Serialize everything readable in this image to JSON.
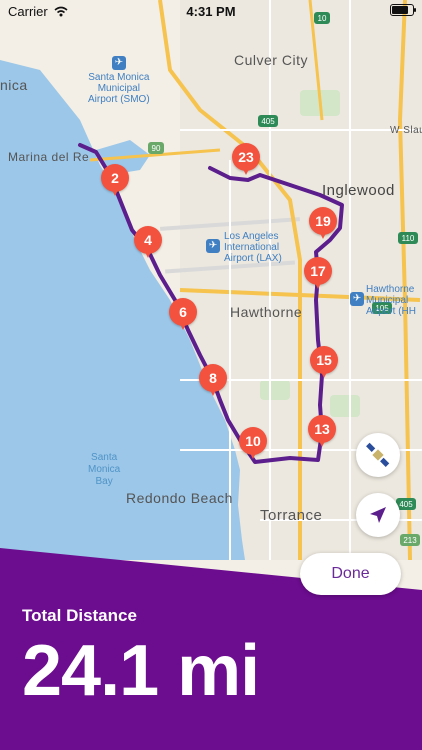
{
  "status_bar": {
    "carrier": "Carrier",
    "time": "4:31 PM"
  },
  "map": {
    "labels": {
      "monica": "nica",
      "marina": "Marina del Re",
      "culver_city": "Culver City",
      "inglewood": "Inglewood",
      "hawthorne": "Hawthorne",
      "redondo": "Redondo Beach",
      "torrance": "Torrance",
      "w_slauson": "W Slau"
    },
    "airports": {
      "smo": [
        "Santa Monica",
        "Municipal",
        "Airport (SMO)"
      ],
      "lax": [
        "Los Angeles",
        "International",
        "Airport (LAX)"
      ],
      "hhr": [
        "Hawthorne",
        "Municipal",
        "Airport (HH"
      ]
    },
    "water": [
      "Santa",
      "Monica",
      "Bay"
    ],
    "highway_shields": [
      "10",
      "90",
      "405",
      "105",
      "110",
      "405",
      "213"
    ],
    "route_color": "#5b1e8c",
    "pin_color": "#f2523e",
    "pins": [
      "2",
      "4",
      "6",
      "8",
      "10",
      "13",
      "15",
      "17",
      "19",
      "23"
    ]
  },
  "controls": {
    "map_style_icon": "satellite-icon",
    "locate_icon": "location-arrow-icon"
  },
  "panel": {
    "done_label": "Done",
    "total_label": "Total Distance",
    "total_value": "24.1 mi",
    "color": "#6c0c8f"
  }
}
